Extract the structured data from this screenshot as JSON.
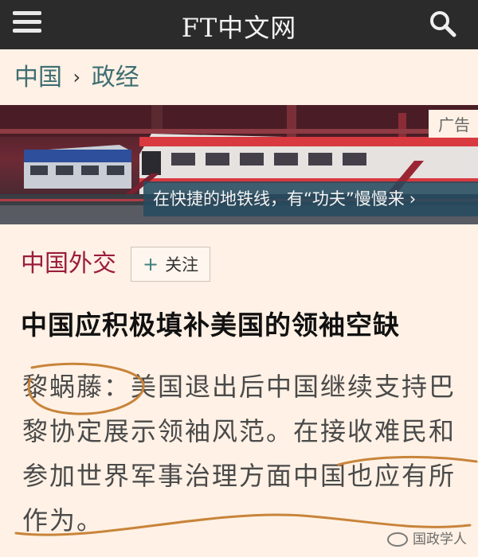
{
  "header": {
    "logo": "FT中文网"
  },
  "breadcrumb": {
    "section": "中国",
    "separator": "›",
    "subsection": "政经"
  },
  "banner": {
    "ad_label": "广告",
    "caption": "在快捷的地铁线，有“功夫”慢慢来",
    "caption_chevron": "›"
  },
  "topic": {
    "label": "中国外交",
    "follow_plus": "+",
    "follow_label": "关注"
  },
  "article": {
    "headline": "中国应积极填补美国的领袖空缺",
    "standfirst": "黎蜗藤：美国退出后中国继续支持巴黎协定展示领袖风范。在接收难民和参加世界军事治理方面中国也应有所作为。"
  },
  "watermark": {
    "text": "国政学人"
  },
  "colors": {
    "header_bg": "#2b2b2b",
    "page_bg": "#fff1e5",
    "topic": "#9b1c3c",
    "breadcrumb": "#3f6e72",
    "annotation": "#c8843a"
  },
  "icons": [
    "menu-icon",
    "search-icon",
    "plus-icon",
    "chevron-right-icon",
    "wechat-icon"
  ]
}
